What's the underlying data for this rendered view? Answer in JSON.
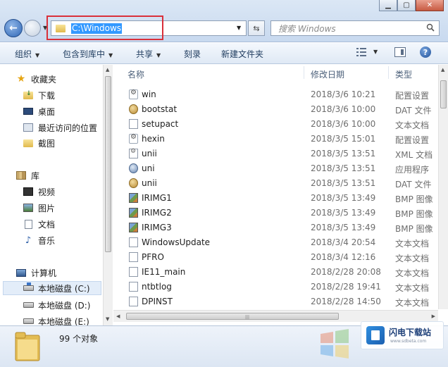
{
  "address": {
    "path": "C:\\Windows"
  },
  "search": {
    "placeholder": "搜索 Windows"
  },
  "toolbar": {
    "organize": "组织",
    "include_in_library": "包含到库中",
    "share": "共享",
    "burn": "刻录",
    "new_folder": "新建文件夹"
  },
  "nav": {
    "favorites": "收藏夹",
    "downloads": "下载",
    "desktop": "桌面",
    "recent": "最近访问的位置",
    "screenshots": "截图",
    "libraries": "库",
    "videos": "视频",
    "pictures": "图片",
    "documents": "文档",
    "music": "音乐",
    "computer": "计算机",
    "drive_c": "本地磁盘 (C:)",
    "drive_d": "本地磁盘 (D:)",
    "drive_e": "本地磁盘 (E:)"
  },
  "columns": {
    "name": "名称",
    "date": "修改日期",
    "type": "类型"
  },
  "files": [
    {
      "name": "win",
      "date": "2018/3/6 10:21",
      "type": "配置设置",
      "icon": "gear"
    },
    {
      "name": "bootstat",
      "date": "2018/3/6 10:00",
      "type": "DAT 文件",
      "icon": "dat"
    },
    {
      "name": "setupact",
      "date": "2018/3/6 10:00",
      "type": "文本文档",
      "icon": "txt"
    },
    {
      "name": "hexin",
      "date": "2018/3/5 15:01",
      "type": "配置设置",
      "icon": "gear"
    },
    {
      "name": "unii",
      "date": "2018/3/5 13:51",
      "type": "XML 文档",
      "icon": "xml"
    },
    {
      "name": "uni",
      "date": "2018/3/5 13:51",
      "type": "应用程序",
      "icon": "app"
    },
    {
      "name": "unii",
      "date": "2018/3/5 13:51",
      "type": "DAT 文件",
      "icon": "dat"
    },
    {
      "name": "IRIMG1",
      "date": "2018/3/5 13:49",
      "type": "BMP 图像",
      "icon": "bmp"
    },
    {
      "name": "IRIMG2",
      "date": "2018/3/5 13:49",
      "type": "BMP 图像",
      "icon": "bmp"
    },
    {
      "name": "IRIMG3",
      "date": "2018/3/5 13:49",
      "type": "BMP 图像",
      "icon": "bmp"
    },
    {
      "name": "WindowsUpdate",
      "date": "2018/3/4 20:54",
      "type": "文本文档",
      "icon": "txt"
    },
    {
      "name": "PFRO",
      "date": "2018/3/4 12:16",
      "type": "文本文档",
      "icon": "txt"
    },
    {
      "name": "IE11_main",
      "date": "2018/2/28 20:08",
      "type": "文本文档",
      "icon": "txt"
    },
    {
      "name": "ntbtlog",
      "date": "2018/2/28 19:41",
      "type": "文本文档",
      "icon": "txt"
    },
    {
      "name": "DPINST",
      "date": "2018/2/28 14:50",
      "type": "文本文档",
      "icon": "txt"
    }
  ],
  "status": {
    "count": "99 个对象"
  },
  "watermark": {
    "title": "闪电下载站",
    "subtitle": "www.sdbeta.com"
  },
  "colors": {
    "selection": "#3399ff",
    "highlight_box": "#d9303a",
    "accent": "#1f4f97"
  }
}
